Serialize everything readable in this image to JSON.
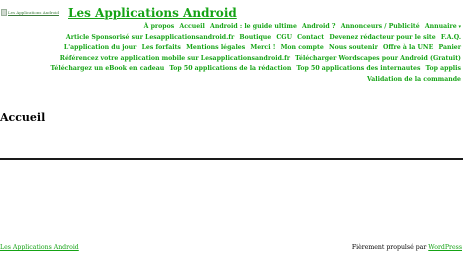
{
  "header": {
    "logo_alt": "Les Applications Android",
    "site_title": "Les Applications Android"
  },
  "nav": {
    "items": [
      {
        "label": "À propos"
      },
      {
        "label": "Accueil"
      },
      {
        "label": "Android : le guide ultime"
      },
      {
        "label": "Android ?"
      },
      {
        "label": "Annonceurs / Publicité"
      },
      {
        "label": "Annuaire",
        "has_dropdown": true
      },
      {
        "label": "Article Sponsorisé sur Lesapplicationsandroid.fr"
      },
      {
        "label": "Boutique"
      },
      {
        "label": "CGU"
      },
      {
        "label": "Contact"
      },
      {
        "label": "Devenez rédacteur pour le site"
      },
      {
        "label": "F.A.Q."
      },
      {
        "label": "L'application du jour"
      },
      {
        "label": "Les forfaits"
      },
      {
        "label": "Mentions légales"
      },
      {
        "label": "Merci !"
      },
      {
        "label": "Mon compte"
      },
      {
        "label": "Nous soutenir"
      },
      {
        "label": "Offre à la UNE"
      },
      {
        "label": "Panier"
      },
      {
        "label": "Référencez votre application mobile sur Lesapplicationsandroid.fr"
      },
      {
        "label": "Télécharger Wordscapes pour Android (Gratuit)"
      },
      {
        "label": "Téléchargez un eBook en cadeau"
      },
      {
        "label": "Top 50 applications de la rédaction"
      },
      {
        "label": "Top 50 applications des internautes"
      },
      {
        "label": "Top applis"
      },
      {
        "label": "Validation de la commande"
      }
    ]
  },
  "main": {
    "page_title": "Accueil"
  },
  "footer": {
    "site_link": "Les Applications Android",
    "credit_prefix": "Fièrement propulsé par ",
    "credit_link": "WordPress"
  },
  "colors": {
    "link": "#15a315",
    "divider": "#1a1a1a",
    "background": "#ffffff"
  }
}
